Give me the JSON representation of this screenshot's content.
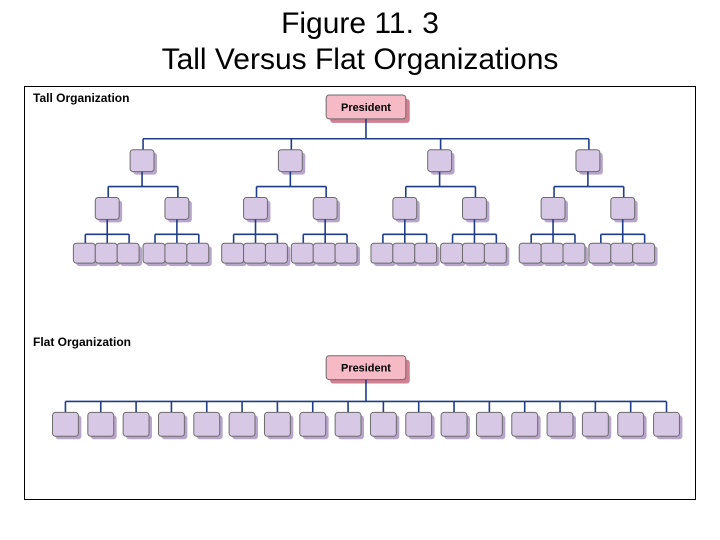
{
  "title": {
    "line1": "Figure 11. 3",
    "line2": "Tall Versus Flat Organizations"
  },
  "tall": {
    "label": "Tall Organization",
    "president": "President"
  },
  "flat": {
    "label": "Flat Organization",
    "president": "President"
  },
  "chart_data": [
    {
      "name": "Tall Organization",
      "type": "tree",
      "root": "President",
      "levels": 4,
      "children_per_node": {
        "level1": 4,
        "level2": 2,
        "level3": 3
      },
      "total_nodes": 37,
      "leaf_count": 24
    },
    {
      "name": "Flat Organization",
      "type": "tree",
      "root": "President",
      "levels": 2,
      "children_per_node": {
        "level1": 18
      },
      "total_nodes": 19,
      "leaf_count": 18
    }
  ]
}
